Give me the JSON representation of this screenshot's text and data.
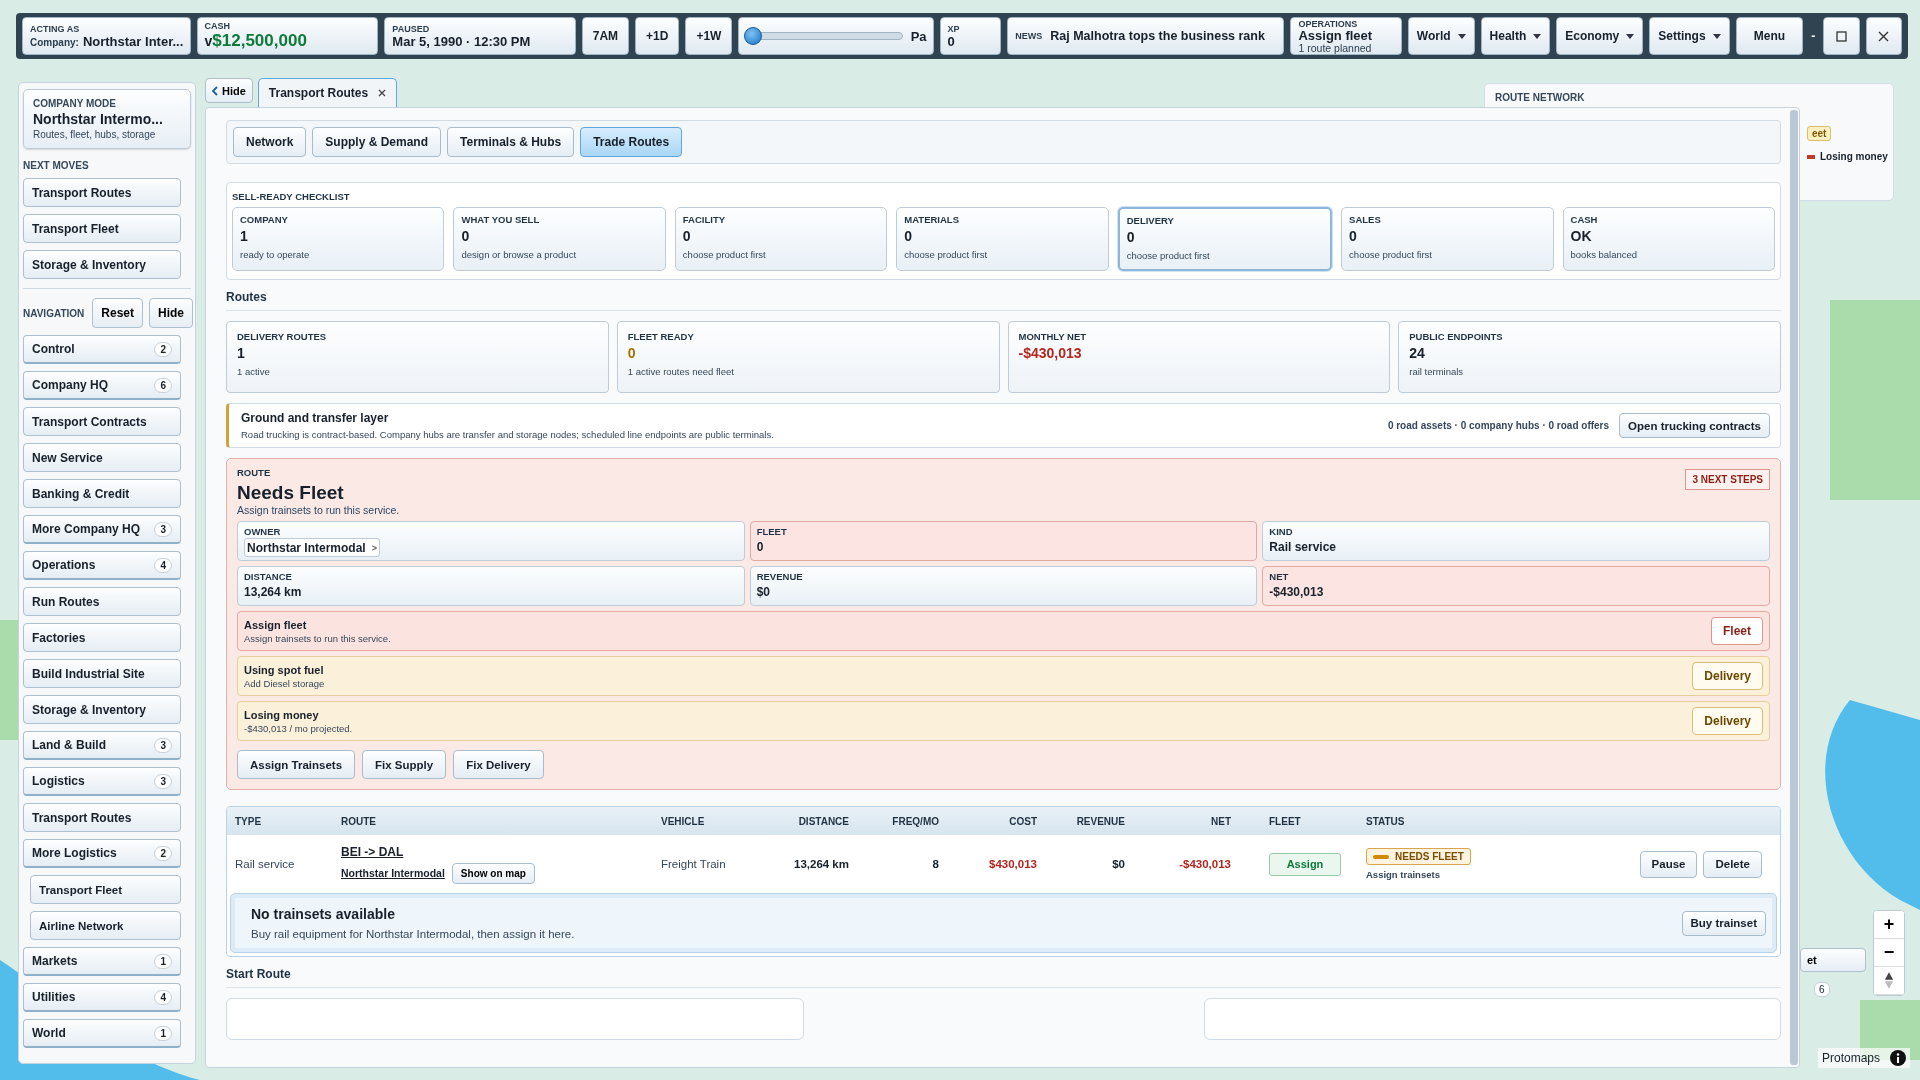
{
  "topbar": {
    "acting": {
      "label": "ACTING AS",
      "company_label": "Company:",
      "company": "Northstar Inter..."
    },
    "cash": {
      "label": "CASH",
      "prefix": "v",
      "value": "$12,500,000"
    },
    "clock": {
      "label": "PAUSED",
      "value": "Mar 5, 1990 · 12:30 PM"
    },
    "time_buttons": [
      "7AM",
      "+1D",
      "+1W"
    ],
    "speed": {
      "level": 0,
      "label": "Pa"
    },
    "xp": {
      "label": "XP",
      "value": "0"
    },
    "news": {
      "label": "NEWS",
      "text": "Raj Malhotra tops the business rank"
    },
    "operations": {
      "label": "OPERATIONS",
      "title": "Assign fleet",
      "subtitle": "1 route planned"
    },
    "menus": [
      "World",
      "Health",
      "Economy",
      "Settings"
    ],
    "menu_button": "Menu",
    "window_controls": [
      {
        "kind": "minimize",
        "label": "-"
      },
      {
        "kind": "maximize"
      },
      {
        "kind": "close"
      }
    ]
  },
  "sidebar": {
    "mode": {
      "label": "COMPANY MODE",
      "title": "Northstar Intermo...",
      "subtitle": "Routes, fleet, hubs, storage"
    },
    "next_moves": {
      "label": "NEXT MOVES",
      "items": [
        "Transport Routes",
        "Transport Fleet",
        "Storage & Inventory"
      ]
    },
    "navigation": {
      "label": "NAVIGATION",
      "buttons": [
        "Reset",
        "Hide"
      ],
      "items": [
        {
          "label": "Control",
          "count": "2"
        },
        {
          "label": "Company HQ",
          "count": "6"
        },
        {
          "label": "Transport Contracts"
        },
        {
          "label": "New Service"
        },
        {
          "label": "Banking & Credit"
        },
        {
          "label": "More Company HQ",
          "count": "3"
        },
        {
          "label": "Operations",
          "count": "4"
        },
        {
          "label": "Run Routes"
        },
        {
          "label": "Factories"
        },
        {
          "label": "Build Industrial Site"
        },
        {
          "label": "Storage & Inventory"
        },
        {
          "label": "Land & Build",
          "count": "3"
        },
        {
          "label": "Logistics",
          "count": "3"
        },
        {
          "label": "Transport Routes"
        },
        {
          "label": "More Logistics",
          "count": "2",
          "children": [
            {
              "label": "Transport Fleet"
            },
            {
              "label": "Airline Network"
            }
          ]
        },
        {
          "label": "Markets",
          "count": "1"
        },
        {
          "label": "Utilities",
          "count": "4"
        },
        {
          "label": "World",
          "count": "1"
        }
      ]
    }
  },
  "workspace": {
    "hide_button": "Hide",
    "tab": {
      "label": "Transport Routes"
    },
    "subtabs": [
      {
        "label": "Network",
        "selected": false
      },
      {
        "label": "Supply & Demand",
        "selected": false
      },
      {
        "label": "Terminals & Hubs",
        "selected": false
      },
      {
        "label": "Trade Routes",
        "selected": true
      }
    ],
    "checklist": {
      "title": "SELL-READY CHECKLIST",
      "steps": [
        {
          "label": "COMPANY",
          "value": "1",
          "note": "ready to operate",
          "selected": false
        },
        {
          "label": "WHAT YOU SELL",
          "value": "0",
          "note": "design or browse a product",
          "selected": false
        },
        {
          "label": "FACILITY",
          "value": "0",
          "note": "choose product first",
          "selected": false
        },
        {
          "label": "MATERIALS",
          "value": "0",
          "note": "choose product first",
          "selected": false
        },
        {
          "label": "DELIVERY",
          "value": "0",
          "note": "choose product first",
          "selected": true
        },
        {
          "label": "SALES",
          "value": "0",
          "note": "choose product first",
          "selected": false
        },
        {
          "label": "CASH",
          "value": "OK",
          "note": "books balanced",
          "selected": false
        }
      ]
    },
    "routes": {
      "title": "Routes",
      "stats": [
        {
          "label": "DELIVERY ROUTES",
          "value": "1",
          "note": "1 active",
          "kind": "plain"
        },
        {
          "label": "FLEET READY",
          "value": "0",
          "note": "1 active routes need fleet",
          "kind": "warning"
        },
        {
          "label": "MONTHLY NET",
          "value": "-$430,013",
          "kind": "negative"
        },
        {
          "label": "PUBLIC ENDPOINTS",
          "value": "24",
          "note": "rail terminals",
          "kind": "plain"
        }
      ]
    },
    "ground": {
      "title": "Ground and transfer layer",
      "text": "Road trucking is contract-based. Company hubs are transfer and storage nodes; scheduled line endpoints are public terminals.",
      "summary": "0 road assets · 0 company hubs · 0 road offers",
      "button": "Open trucking contracts"
    },
    "route_card": {
      "label": "ROUTE",
      "title": "Needs Fleet",
      "subtitle": "Assign trainsets to run this service.",
      "badge": "3 NEXT STEPS",
      "fields": [
        {
          "label": "OWNER",
          "value": "Northstar Intermodal",
          "kind": "link"
        },
        {
          "label": "FLEET",
          "value": "0",
          "kind": "alert"
        },
        {
          "label": "KIND",
          "value": "Rail service",
          "kind": "info"
        },
        {
          "label": "DISTANCE",
          "value": "13,264 km",
          "kind": "info"
        },
        {
          "label": "REVENUE",
          "value": "$0",
          "kind": "info"
        },
        {
          "label": "NET",
          "value": "-$430,013",
          "kind": "alert"
        }
      ],
      "owner_chevron": ">",
      "issues": [
        {
          "title": "Assign fleet",
          "text": "Assign trainsets to run this service.",
          "button": "Fleet",
          "kind": "error"
        },
        {
          "title": "Using spot fuel",
          "text": "Add Diesel storage",
          "button": "Delivery",
          "kind": "warning"
        },
        {
          "title": "Losing money",
          "text": "-$430,013 / mo projected.",
          "button": "Delivery",
          "kind": "warning"
        }
      ],
      "actions": [
        "Assign Trainsets",
        "Fix Supply",
        "Fix Delivery"
      ]
    },
    "table": {
      "columns": [
        "TYPE",
        "ROUTE",
        "VEHICLE",
        "DISTANCE",
        "FREQ/MO",
        "COST",
        "REVENUE",
        "NET",
        "FLEET",
        "STATUS"
      ],
      "rows": [
        {
          "type": "Rail service",
          "route": "BEI -> DAL",
          "owner": "Northstar Intermodal",
          "map_button": "Show on map",
          "vehicle": "Freight Train",
          "distance": "13,264 km",
          "freq": "8",
          "cost": "$430,013",
          "revenue": "$0",
          "net": "-$430,013",
          "fleet_button": "Assign",
          "status": "NEEDS FLEET",
          "status_note": "Assign trainsets",
          "actions": [
            "Pause",
            "Delete"
          ]
        }
      ]
    },
    "notice": {
      "title": "No trainsets available",
      "text": "Buy rail equipment for Northstar Intermodal, then assign it here.",
      "button": "Buy trainset"
    },
    "start_route": {
      "title": "Start Route"
    }
  },
  "route_network": {
    "title": "ROUTE NETWORK",
    "badge": "eet",
    "legend": {
      "label": "Losing money",
      "color": "#c0392b"
    }
  },
  "map": {
    "widget_button": "et",
    "widget_count": "6",
    "zoom_buttons": [
      "+",
      "−"
    ],
    "attribution": "Protomaps"
  }
}
